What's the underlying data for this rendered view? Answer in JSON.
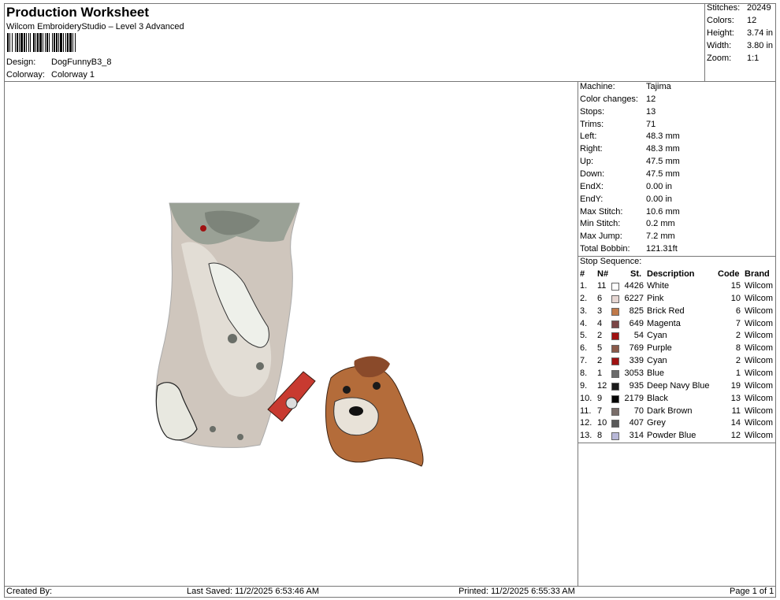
{
  "header": {
    "title": "Production Worksheet",
    "subtitle": "Wilcom EmbroideryStudio – Level 3 Advanced",
    "design_label": "Design:",
    "design_value": "DogFunnyB3_8",
    "colorway_label": "Colorway:",
    "colorway_value": "Colorway 1"
  },
  "top_stats": [
    {
      "label": "Stitches:",
      "value": "20249"
    },
    {
      "label": "Colors:",
      "value": "12"
    },
    {
      "label": "Height:",
      "value": "3.74 in"
    },
    {
      "label": "Width:",
      "value": "3.80 in"
    },
    {
      "label": "Zoom:",
      "value": "1:1"
    }
  ],
  "machine_info": [
    {
      "label": "Machine:",
      "value": "Tajima"
    },
    {
      "label": "Color changes:",
      "value": "12"
    },
    {
      "label": "Stops:",
      "value": "13"
    },
    {
      "label": "Trims:",
      "value": "71"
    },
    {
      "label": "Left:",
      "value": "48.3 mm"
    },
    {
      "label": "Right:",
      "value": "48.3 mm"
    },
    {
      "label": "Up:",
      "value": "47.5 mm"
    },
    {
      "label": "Down:",
      "value": "47.5 mm"
    },
    {
      "label": "EndX:",
      "value": "0.00 in"
    },
    {
      "label": "EndY:",
      "value": "0.00 in"
    },
    {
      "label": "Max Stitch:",
      "value": "10.6 mm"
    },
    {
      "label": "Min Stitch:",
      "value": "0.2 mm"
    },
    {
      "label": "Max Jump:",
      "value": "7.2 mm"
    },
    {
      "label": "Total Bobbin:",
      "value": "121.31ft"
    }
  ],
  "stop_sequence": {
    "title": "Stop Sequence:",
    "headers": {
      "num": "#",
      "n": "N#",
      "st": "St.",
      "desc": "Description",
      "code": "Code",
      "brand": "Brand"
    },
    "rows": [
      {
        "num": "1.",
        "n": "11",
        "color": "#ffffff",
        "st": "4426",
        "desc": "White",
        "code": "15",
        "brand": "Wilcom"
      },
      {
        "num": "2.",
        "n": "6",
        "color": "#e6d6d2",
        "st": "6227",
        "desc": "Pink",
        "code": "10",
        "brand": "Wilcom"
      },
      {
        "num": "3.",
        "n": "3",
        "color": "#c07a4a",
        "st": "825",
        "desc": "Brick Red",
        "code": "6",
        "brand": "Wilcom"
      },
      {
        "num": "4.",
        "n": "4",
        "color": "#7a4545",
        "st": "649",
        "desc": "Magenta",
        "code": "7",
        "brand": "Wilcom"
      },
      {
        "num": "5.",
        "n": "2",
        "color": "#a01212",
        "st": "54",
        "desc": "Cyan",
        "code": "2",
        "brand": "Wilcom"
      },
      {
        "num": "6.",
        "n": "5",
        "color": "#8a5a4a",
        "st": "769",
        "desc": "Purple",
        "code": "8",
        "brand": "Wilcom"
      },
      {
        "num": "7.",
        "n": "2",
        "color": "#a01212",
        "st": "339",
        "desc": "Cyan",
        "code": "2",
        "brand": "Wilcom"
      },
      {
        "num": "8.",
        "n": "1",
        "color": "#6a6a6a",
        "st": "3053",
        "desc": "Blue",
        "code": "1",
        "brand": "Wilcom"
      },
      {
        "num": "9.",
        "n": "12",
        "color": "#1a1a1a",
        "st": "935",
        "desc": "Deep Navy Blue",
        "code": "19",
        "brand": "Wilcom"
      },
      {
        "num": "10.",
        "n": "9",
        "color": "#050505",
        "st": "2179",
        "desc": "Black",
        "code": "13",
        "brand": "Wilcom"
      },
      {
        "num": "11.",
        "n": "7",
        "color": "#7a6e6a",
        "st": "70",
        "desc": "Dark Brown",
        "code": "11",
        "brand": "Wilcom"
      },
      {
        "num": "12.",
        "n": "10",
        "color": "#5a5a5a",
        "st": "407",
        "desc": "Grey",
        "code": "14",
        "brand": "Wilcom"
      },
      {
        "num": "13.",
        "n": "8",
        "color": "#b8b8d8",
        "st": "314",
        "desc": "Powder Blue",
        "code": "12",
        "brand": "Wilcom"
      }
    ]
  },
  "footer": {
    "created_by": "Created By:",
    "last_saved": "Last Saved: 11/2/2025 6:53:46 AM",
    "printed": "Printed: 11/2/2025 6:55:33 AM",
    "page": "Page 1 of 1"
  }
}
